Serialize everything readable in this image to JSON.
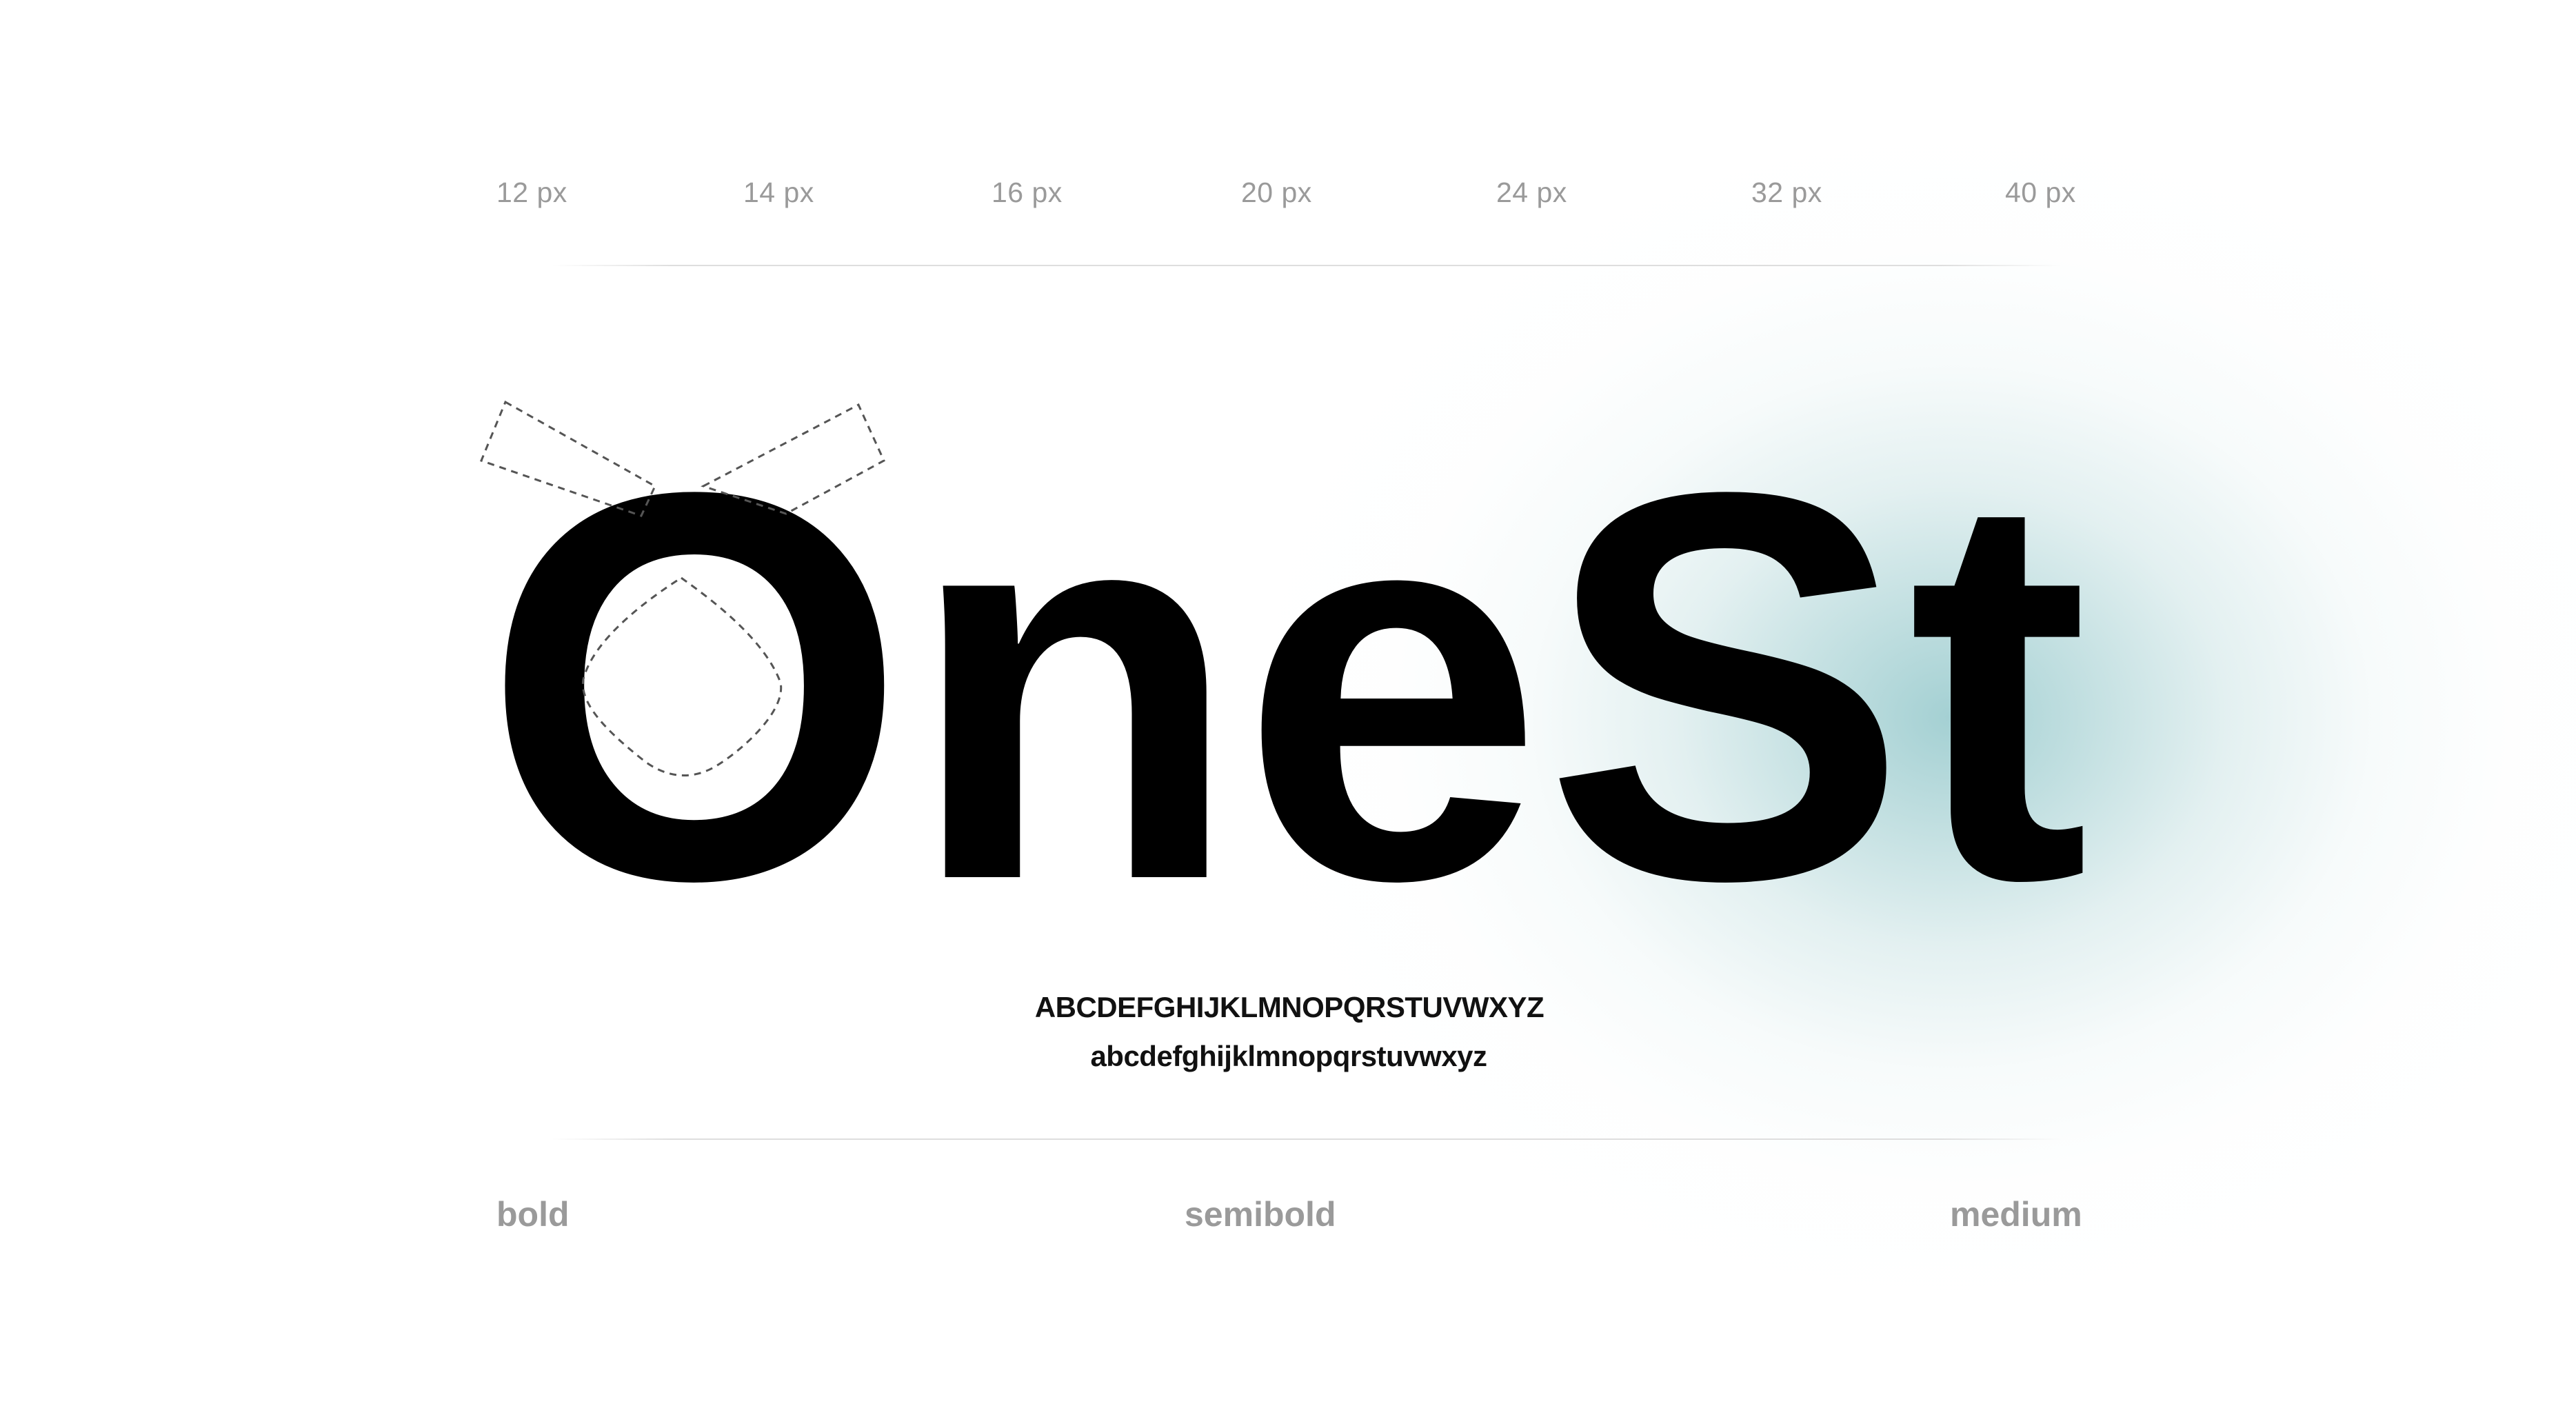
{
  "sizes": [
    "12 px",
    "14 px",
    "16 px",
    "20 px",
    "24 px",
    "32 px",
    "40 px"
  ],
  "wordmark": "OneSt",
  "alphabet": {
    "uppercase": "ABCDEFGHIJKLMNOPQRSTUVWXYZ",
    "lowercase": "abcdefghijklmnopqrstuvwxyz"
  },
  "weights": [
    "bold",
    "semibold",
    "medium"
  ],
  "colors": {
    "background": "#ffffff",
    "text_primary": "#000000",
    "text_muted": "#9a9a9a",
    "glow": "#9ccccf"
  }
}
